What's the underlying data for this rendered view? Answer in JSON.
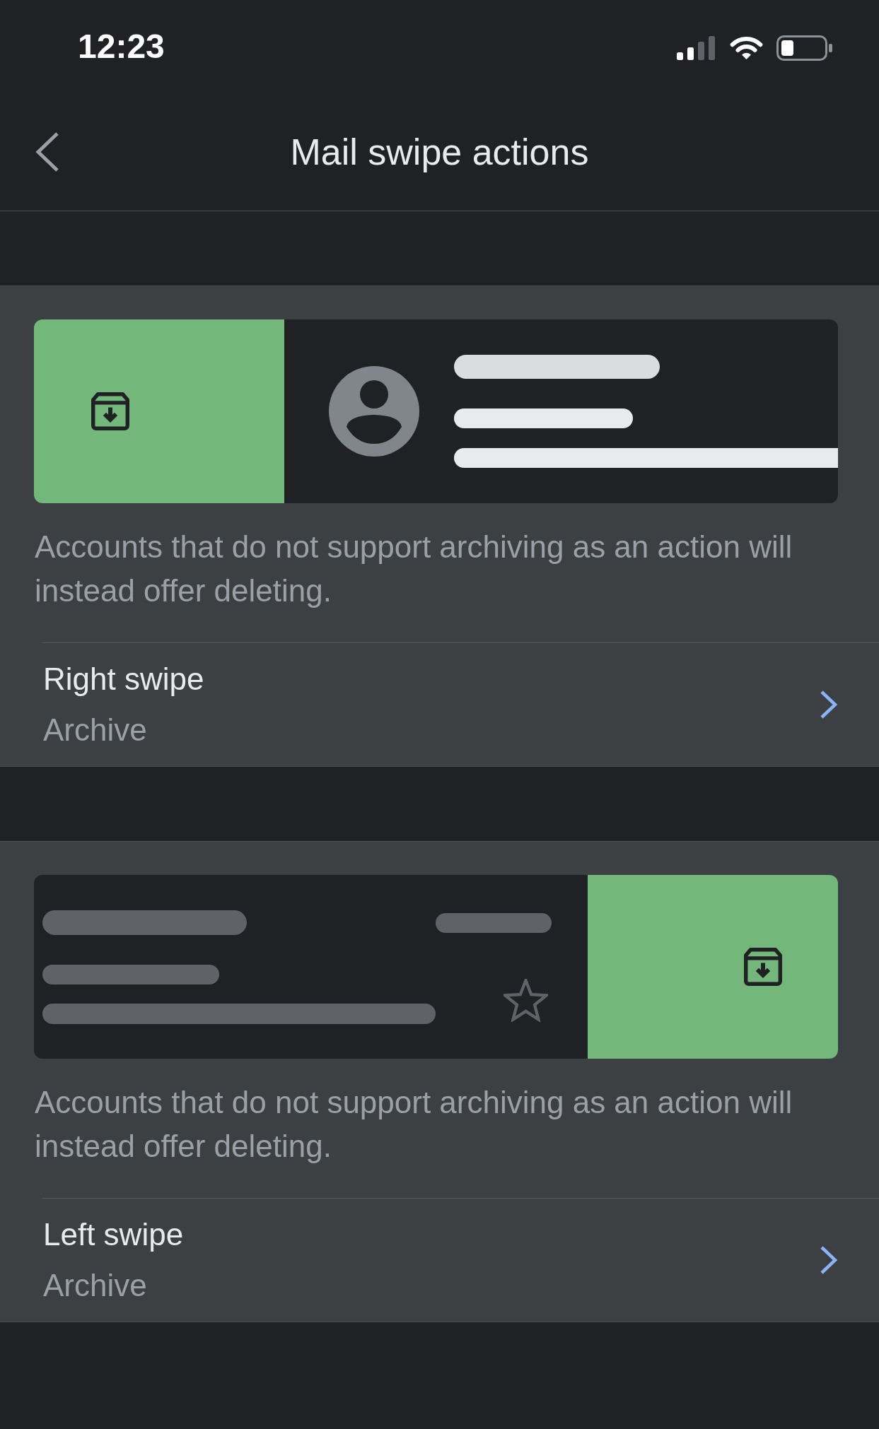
{
  "status_bar": {
    "time": "12:23"
  },
  "header": {
    "title": "Mail swipe actions"
  },
  "sections": [
    {
      "kind": "right_swipe",
      "note": "Accounts that do not support archiving as an action will instead offer deleting.",
      "setting": {
        "label": "Right swipe",
        "value": "Archive"
      }
    },
    {
      "kind": "left_swipe",
      "note": "Accounts that do not support archiving as an action will instead offer deleting.",
      "setting": {
        "label": "Left swipe",
        "value": "Archive"
      }
    }
  ]
}
